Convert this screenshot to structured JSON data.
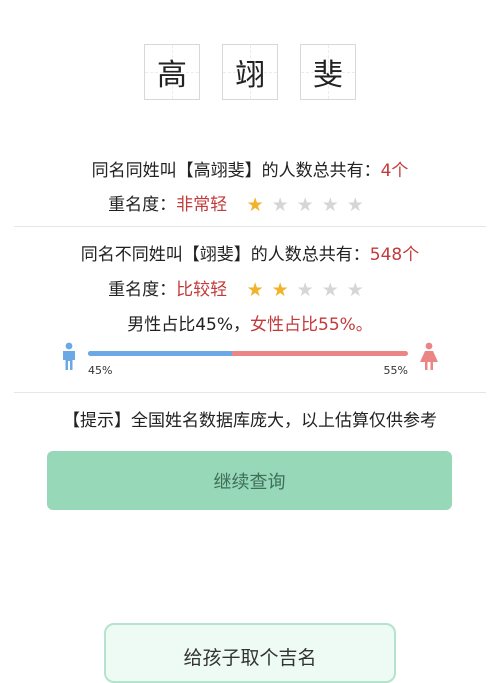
{
  "name_chars": [
    "高",
    "翊",
    "斐"
  ],
  "same_name_same_surname": {
    "prefix": "同名同姓叫【高翊斐】的人数总共有：",
    "count": "4个",
    "label": "重名度：",
    "level": "非常轻",
    "stars_filled": 1,
    "stars_total": 5
  },
  "same_name_diff_surname": {
    "prefix": "同名不同姓叫【翊斐】的人数总共有：",
    "count": "548个",
    "label": "重名度：",
    "level": "比较轻",
    "stars_filled": 2,
    "stars_total": 5
  },
  "gender": {
    "male_text": "男性占比45%，",
    "female_text": "女性占比55%。",
    "male_pct_label": "45%",
    "female_pct_label": "55%",
    "male_share": 0.45
  },
  "tip": "【提示】全国姓名数据库庞大，以上估算仅供参考",
  "continue_button": "继续查询",
  "name_child_button": "给孩子取个吉名",
  "colors": {
    "accent_red": "#c33a3a",
    "star_on": "#f1b22c",
    "male_blue": "#6aa8e6",
    "female_red": "#eb8585",
    "button_green": "#96d8b8"
  }
}
